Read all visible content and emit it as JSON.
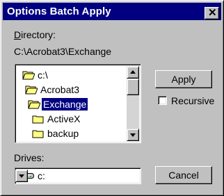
{
  "window": {
    "title": "Options Batch Apply",
    "close_glyph": "✕"
  },
  "directory": {
    "label_access": "D",
    "label_rest": "irectory:",
    "path": "C:\\Acrobat3\\Exchange"
  },
  "folder_list": {
    "items": [
      {
        "label": "c:\\",
        "icon": "open-folder-icon",
        "selected": false
      },
      {
        "label": "Acrobat3",
        "icon": "open-folder-icon",
        "selected": false
      },
      {
        "label": "Exchange",
        "icon": "open-folder-icon",
        "selected": true
      },
      {
        "label": "ActiveX",
        "icon": "folder-icon",
        "selected": false
      },
      {
        "label": "backup",
        "icon": "folder-icon",
        "selected": false
      }
    ]
  },
  "buttons": {
    "apply": "Apply",
    "cancel": "Cancel"
  },
  "recursive": {
    "label": "Recursive",
    "checked": false
  },
  "drives": {
    "label": "Drives:",
    "selected": "c:"
  },
  "colors": {
    "face": "#c0c0c0",
    "titlebar": "#000080",
    "selection": "#000080",
    "folder": "#ffff80"
  }
}
